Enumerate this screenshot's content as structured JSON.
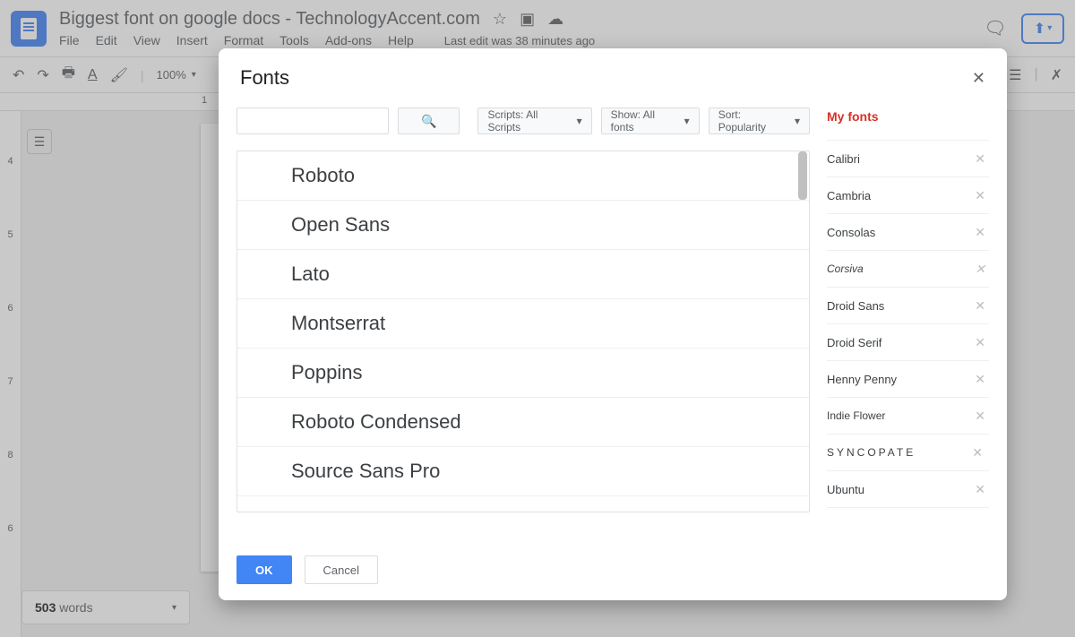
{
  "header": {
    "doc_title": "Biggest font on google docs - TechnologyAccent.com",
    "last_edit": "Last edit was 38 minutes ago"
  },
  "menubar": {
    "file": "File",
    "edit": "Edit",
    "view": "View",
    "insert": "Insert",
    "format": "Format",
    "tools": "Tools",
    "addons": "Add-ons",
    "help": "Help"
  },
  "toolbar": {
    "zoom": "100%"
  },
  "v_ruler": {
    "r4": "4",
    "r5": "5",
    "r6": "6",
    "r7": "7",
    "r8": "8",
    "r6b": "6"
  },
  "word_count": {
    "num": "503",
    "label": " words"
  },
  "dialog": {
    "title": "Fonts",
    "filters": {
      "scripts": "Scripts: All Scripts",
      "show": "Show: All fonts",
      "sort": "Sort: Popularity"
    },
    "fonts": {
      "0": "Roboto",
      "1": "Open Sans",
      "2": "Lato",
      "3": "Montserrat",
      "4": "Poppins",
      "5": "Roboto Condensed",
      "6": "Source Sans Pro"
    },
    "myfonts_title": "My fonts",
    "myfonts": {
      "0": "Calibri",
      "1": "Cambria",
      "2": "Consolas",
      "3": "Corsiva",
      "4": "Droid Sans",
      "5": "Droid Serif",
      "6": "Henny Penny",
      "7": "Indie Flower",
      "8": "Syncopate",
      "9": "Ubuntu"
    },
    "ok": "OK",
    "cancel": "Cancel"
  }
}
